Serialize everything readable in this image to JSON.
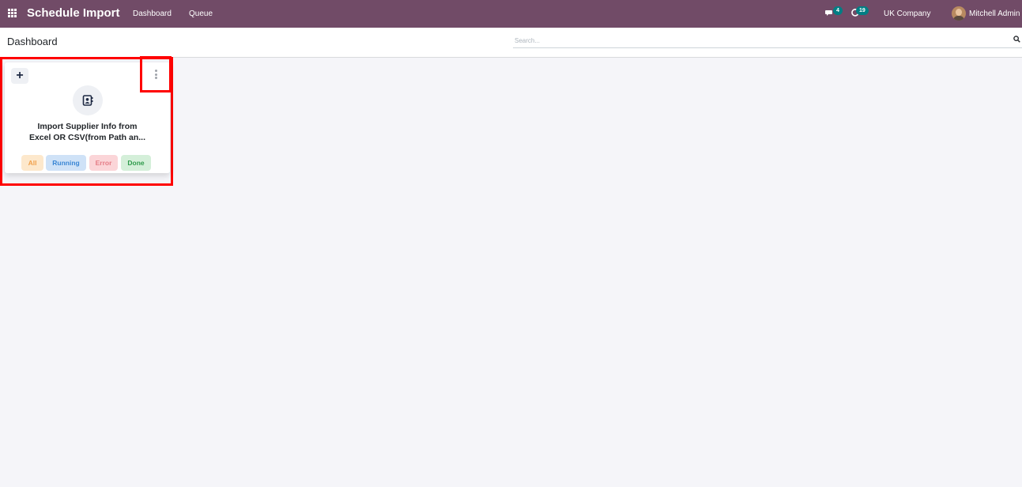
{
  "navbar": {
    "app_title": "Schedule Import",
    "menu": [
      "Dashboard",
      "Queue"
    ],
    "messages_count": "4",
    "activities_count": "19",
    "company": "UK Company",
    "user": "Mitchell Admin",
    "color": "#714b67"
  },
  "control_panel": {
    "title": "Dashboard",
    "search_placeholder": "Search..."
  },
  "card": {
    "title_line1": "Import Supplier Info from",
    "title_line2": "Excel OR CSV(from Path an...",
    "statuses": [
      {
        "label": "All",
        "bg": "#fde8cc",
        "color": "#f0a04b"
      },
      {
        "label": "Running",
        "bg": "#cfe2f7",
        "color": "#3a86d4"
      },
      {
        "label": "Error",
        "bg": "#fbd5d8",
        "color": "#e57b85"
      },
      {
        "label": "Done",
        "bg": "#d4efd9",
        "color": "#2e9a4a"
      }
    ]
  },
  "highlight_color": "#ff0000",
  "icons": [
    "apps-icon",
    "chat-icon",
    "activity-icon",
    "search-icon",
    "plus-icon",
    "kebab-menu-icon",
    "address-book-icon"
  ]
}
